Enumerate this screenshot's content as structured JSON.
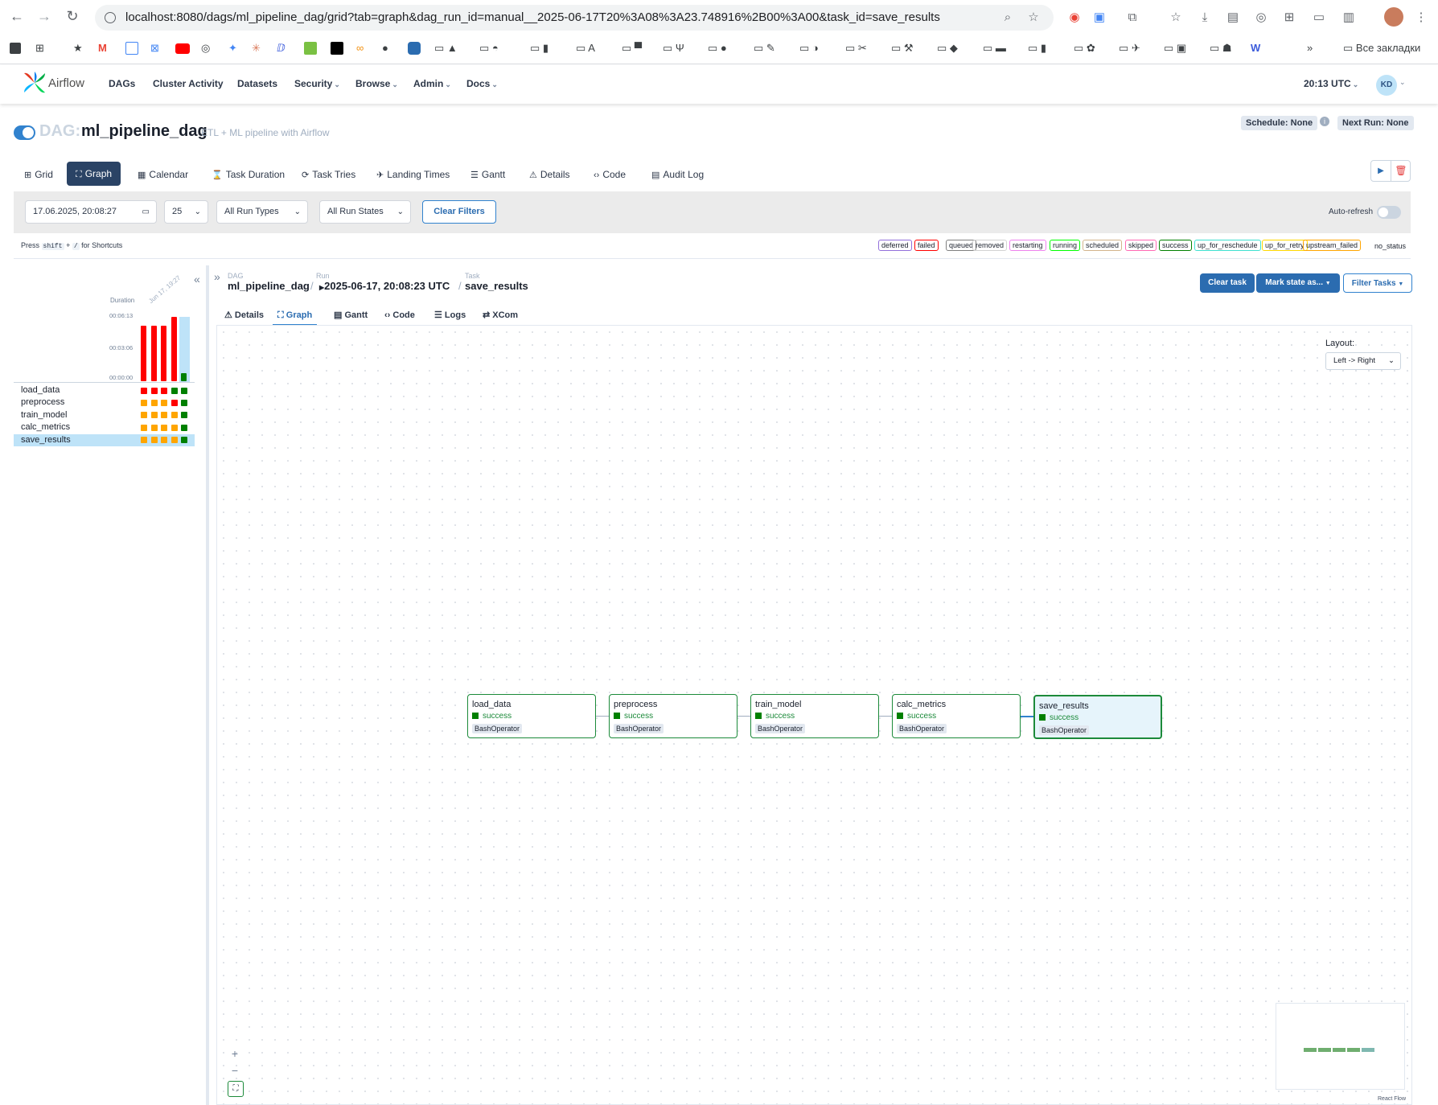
{
  "browser": {
    "url": "localhost:8080/dags/ml_pipeline_dag/grid?tab=graph&dag_run_id=manual__2025-06-17T20%3A08%3A23.748916%2B00%3A00&task_id=save_results",
    "bookmarks": [
      "A",
      "Ψ",
      "Все закладки",
      "W"
    ]
  },
  "app": {
    "brand": "Airflow",
    "nav": [
      "DAGs",
      "Cluster Activity",
      "Datasets",
      "Security",
      "Browse",
      "Admin",
      "Docs"
    ],
    "clock": "20:13 UTC",
    "user_initials": "KD"
  },
  "dag": {
    "prefix": "DAG:",
    "name": "ml_pipeline_dag",
    "description": "ETL + ML pipeline with Airflow",
    "schedule": "Schedule: None",
    "next_run": "Next Run: None"
  },
  "view_tabs": [
    "Grid",
    "Graph",
    "Calendar",
    "Task Duration",
    "Task Tries",
    "Landing Times",
    "Gantt",
    "Details",
    "Code",
    "Audit Log"
  ],
  "filters": {
    "date": "17.06.2025, 20:08:27",
    "limit": "25",
    "run_types": "All Run Types",
    "run_states": "All Run States",
    "clear": "Clear Filters",
    "auto_refresh": "Auto-refresh"
  },
  "shortcuts": {
    "press": "Press",
    "key1": "shift",
    "plus": "+",
    "key2": "/",
    "suffix": "for Shortcuts"
  },
  "state_legend": [
    "deferred",
    "failed",
    "queued",
    "removed",
    "restarting",
    "running",
    "scheduled",
    "skipped",
    "success",
    "up_for_reschedule",
    "up_for_retry",
    "upstream_failed",
    "no_status"
  ],
  "state_colors": {
    "deferred": "#9370db",
    "failed": "#ff0000",
    "queued": "#808080",
    "removed": "#d3d3d3",
    "restarting": "#ee82ee",
    "running": "#00ff00",
    "scheduled": "#d2b48c",
    "skipped": "#ff69b4",
    "success": "#008000",
    "up_for_reschedule": "#40e0d0",
    "up_for_retry": "#ffd700",
    "upstream_failed": "#ffa500",
    "no_status": "#ffffff"
  },
  "duration": {
    "label": "Duration",
    "ticks": [
      "00:06:13",
      "00:03:06",
      "00:00:00"
    ],
    "date_label": "Jun 17, 19:27",
    "runs": [
      {
        "state": "failed",
        "fraction": 0.86
      },
      {
        "state": "failed",
        "fraction": 0.86
      },
      {
        "state": "failed",
        "fraction": 0.86
      },
      {
        "state": "failed",
        "fraction": 1.0
      },
      {
        "state": "success",
        "fraction": 0.12
      }
    ]
  },
  "tasks": [
    {
      "name": "load_data",
      "states": [
        "failed",
        "failed",
        "failed",
        "success",
        "success"
      ]
    },
    {
      "name": "preprocess",
      "states": [
        "upstream_failed",
        "upstream_failed",
        "upstream_failed",
        "failed",
        "success"
      ]
    },
    {
      "name": "train_model",
      "states": [
        "upstream_failed",
        "upstream_failed",
        "upstream_failed",
        "upstream_failed",
        "success"
      ]
    },
    {
      "name": "calc_metrics",
      "states": [
        "upstream_failed",
        "upstream_failed",
        "upstream_failed",
        "upstream_failed",
        "success"
      ]
    },
    {
      "name": "save_results",
      "states": [
        "upstream_failed",
        "upstream_failed",
        "upstream_failed",
        "upstream_failed",
        "success"
      ]
    }
  ],
  "breadcrumb": {
    "dag_label": "DAG",
    "dag": "ml_pipeline_dag",
    "run_label": "Run",
    "run": "2025-06-17, 20:08:23 UTC",
    "task_label": "Task",
    "task": "save_results",
    "sep": "/"
  },
  "actions": {
    "clear_task": "Clear task",
    "mark_state": "Mark state as...",
    "filter_tasks": "Filter Tasks"
  },
  "detail_tabs": [
    "Details",
    "Graph",
    "Gantt",
    "Code",
    "Logs",
    "XCom"
  ],
  "graph": {
    "layout_label": "Layout:",
    "layout_value": "Left -> Right",
    "nodes": [
      {
        "name": "load_data",
        "state": "success",
        "operator": "BashOperator"
      },
      {
        "name": "preprocess",
        "state": "success",
        "operator": "BashOperator"
      },
      {
        "name": "train_model",
        "state": "success",
        "operator": "BashOperator"
      },
      {
        "name": "calc_metrics",
        "state": "success",
        "operator": "BashOperator"
      },
      {
        "name": "save_results",
        "state": "success",
        "operator": "BashOperator"
      }
    ],
    "attribution": "React Flow",
    "zoom_in": "+",
    "zoom_out": "−"
  },
  "colors": {
    "accent": "#2b6cb0",
    "brand": "#017cee",
    "success": "#008000",
    "failed": "#ff0000",
    "upstream_failed": "#ffa500",
    "selected_row": "#bee3f8"
  }
}
